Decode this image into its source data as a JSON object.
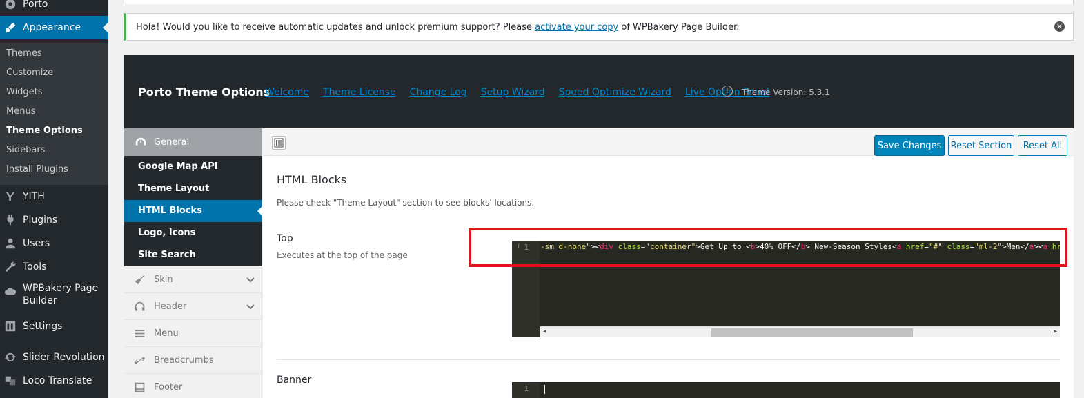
{
  "admin_menu": {
    "items": [
      {
        "label": "Porto",
        "icon": "porto-icon"
      },
      {
        "label": "Appearance",
        "icon": "paintbrush-icon",
        "current": true
      },
      {
        "label": "YITH",
        "icon": "yith-icon"
      },
      {
        "label": "Plugins",
        "icon": "plugin-icon"
      },
      {
        "label": "Users",
        "icon": "user-icon"
      },
      {
        "label": "Tools",
        "icon": "wrench-icon"
      },
      {
        "label": "WPBakery Page Builder",
        "icon": "cloud-icon"
      },
      {
        "label": "Settings",
        "icon": "settings-icon"
      },
      {
        "label": "Slider Revolution",
        "icon": "refresh-icon"
      },
      {
        "label": "Loco Translate",
        "icon": "translate-icon"
      }
    ],
    "appearance_sub": [
      "Themes",
      "Customize",
      "Widgets",
      "Menus",
      "Theme Options",
      "Sidebars",
      "Install Plugins"
    ],
    "active_sub": "Theme Options"
  },
  "notice": {
    "text_before": "Hola! Would you like to receive automatic updates and unlock premium support? Please ",
    "link": "activate your copy",
    "text_after": " of WPBakery Page Builder.",
    "accent": "#46b450"
  },
  "porto_header": {
    "title": "Porto Theme Options",
    "links": [
      "Welcome",
      "Theme License",
      "Change Log",
      "Setup Wizard",
      "Speed Optimize Wizard",
      "Live Option Panel"
    ],
    "info": "!",
    "version": "Theme Version: 5.3.1"
  },
  "options_nav": {
    "general": "General",
    "general_subs": [
      "Google Map API",
      "Theme Layout",
      "HTML Blocks",
      "Logo, Icons",
      "Site Search"
    ],
    "active_sub": "HTML Blocks",
    "sections": [
      {
        "label": "Skin",
        "icon": "broom-icon",
        "expandable": true
      },
      {
        "label": "Header",
        "icon": "headphones-icon",
        "expandable": true
      },
      {
        "label": "Menu",
        "icon": "menu-icon",
        "expandable": false
      },
      {
        "label": "Breadcrumbs",
        "icon": "link-icon",
        "expandable": false
      },
      {
        "label": "Footer",
        "icon": "footer-icon",
        "expandable": false
      }
    ]
  },
  "toolbar": {
    "save": "Save Changes",
    "reset_section": "Reset Section",
    "reset_all": "Reset All",
    "primary_color": "#0085ba"
  },
  "section": {
    "title": "HTML Blocks",
    "description": "Please check \"Theme Layout\" section to see blocks' locations."
  },
  "fields": {
    "top": {
      "label": "Top",
      "description": "Executes at the top of the page",
      "line_number": "1",
      "gutter_mark": "i",
      "code_tokens": [
        {
          "t": "-sm d-none\"",
          "c": "tk-str"
        },
        {
          "t": "><",
          "c": ""
        },
        {
          "t": "div",
          "c": "tk-tag"
        },
        {
          "t": " ",
          "c": ""
        },
        {
          "t": "class",
          "c": "tk-attr"
        },
        {
          "t": "=",
          "c": ""
        },
        {
          "t": "\"container\"",
          "c": "tk-str"
        },
        {
          "t": ">Get Up to <",
          "c": ""
        },
        {
          "t": "b",
          "c": "tk-tag"
        },
        {
          "t": ">40% OFF</",
          "c": ""
        },
        {
          "t": "b",
          "c": "tk-tag"
        },
        {
          "t": "> New-Season Styles<",
          "c": ""
        },
        {
          "t": "a",
          "c": "tk-tag"
        },
        {
          "t": " ",
          "c": ""
        },
        {
          "t": "href",
          "c": "tk-attr"
        },
        {
          "t": "=",
          "c": ""
        },
        {
          "t": "\"#\"",
          "c": "tk-str"
        },
        {
          "t": " ",
          "c": ""
        },
        {
          "t": "class",
          "c": "tk-attr"
        },
        {
          "t": "=",
          "c": ""
        },
        {
          "t": "\"ml-2\"",
          "c": "tk-str"
        },
        {
          "t": ">Men</",
          "c": ""
        },
        {
          "t": "a",
          "c": "tk-tag"
        },
        {
          "t": "><",
          "c": ""
        },
        {
          "t": "a",
          "c": "tk-tag"
        },
        {
          "t": " ",
          "c": ""
        },
        {
          "t": "href",
          "c": "tk-attr"
        },
        {
          "t": "=\"#\"",
          "c": ""
        }
      ]
    },
    "banner": {
      "label": "Banner",
      "line_number": "1"
    }
  },
  "highlight_color": "#e0141e"
}
